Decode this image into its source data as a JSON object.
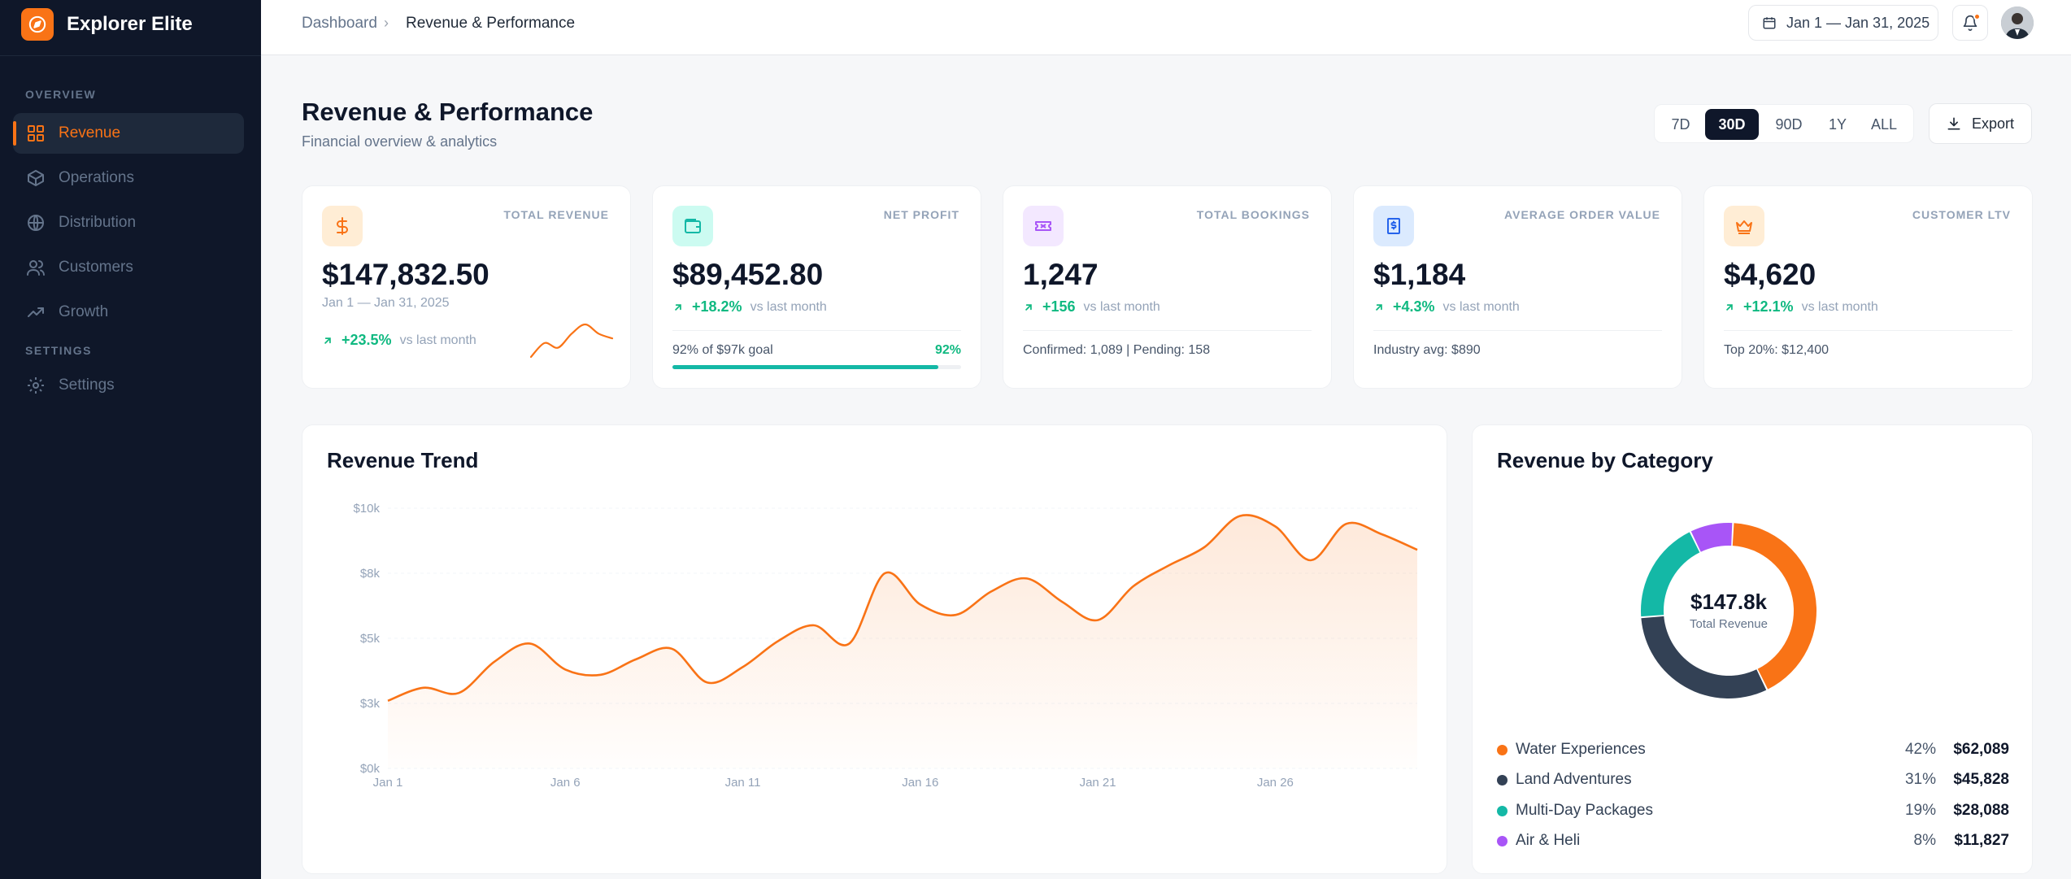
{
  "app": {
    "name": "Explorer Elite"
  },
  "sidebar": {
    "sections": [
      "OVERVIEW",
      "SETTINGS"
    ],
    "items": [
      {
        "label": "Revenue",
        "icon": "grid-icon",
        "active": true
      },
      {
        "label": "Operations",
        "icon": "box-icon"
      },
      {
        "label": "Distribution",
        "icon": "globe-icon"
      },
      {
        "label": "Customers",
        "icon": "users-icon"
      },
      {
        "label": "Growth",
        "icon": "trend-icon"
      }
    ],
    "settings_item": {
      "label": "Settings",
      "icon": "gear-icon"
    }
  },
  "topbar": {
    "breadcrumb": [
      "Dashboard",
      "Revenue & Performance"
    ],
    "date_range": "Jan 1 — Jan 31, 2025"
  },
  "header": {
    "title": "Revenue & Performance",
    "subtitle": "Financial overview & analytics",
    "ranges": [
      "7D",
      "30D",
      "90D",
      "1Y",
      "ALL"
    ],
    "active_range": "30D",
    "export_label": "Export"
  },
  "kpis": [
    {
      "label": "TOTAL REVENUE",
      "value": "$147,832.50",
      "date": "Jan 1 — Jan 31, 2025",
      "change": "+23.5%",
      "vs": "vs last month",
      "icon": "dollar-icon",
      "accent": "#f97316",
      "icon_bg": "#ffedd5",
      "sparkline": [
        3,
        6,
        5,
        8,
        10,
        8,
        7
      ]
    },
    {
      "label": "NET PROFIT",
      "value": "$89,452.80",
      "change": "+18.2%",
      "vs": "vs last month",
      "footer": "92% of $97k goal",
      "footer_right": "92%",
      "progress": 0.92,
      "icon": "wallet-icon",
      "accent": "#14b8a6",
      "icon_bg": "#ccfbf1"
    },
    {
      "label": "TOTAL BOOKINGS",
      "value": "1,247",
      "change": "+156",
      "vs": "vs last month",
      "footer": "Confirmed: 1,089 | Pending: 158",
      "icon": "ticket-icon",
      "accent": "#a855f7",
      "icon_bg": "#f3e8ff"
    },
    {
      "label": "AVERAGE ORDER VALUE",
      "value": "$1,184",
      "change": "+4.3%",
      "vs": "vs last month",
      "footer": "Industry avg: $890",
      "icon": "receipt-icon",
      "accent": "#2563eb",
      "icon_bg": "#dbeafe"
    },
    {
      "label": "CUSTOMER LTV",
      "value": "$4,620",
      "change": "+12.1%",
      "vs": "vs last month",
      "footer": "Top 20%: $12,400",
      "icon": "crown-icon",
      "accent": "#f97316",
      "icon_bg": "#ffedd5"
    }
  ],
  "trend": {
    "title": "Revenue Trend",
    "color": "#f97316"
  },
  "category": {
    "title": "Revenue by Category",
    "center_value": "$147.8k",
    "center_label": "Total Revenue",
    "items": [
      {
        "name": "Water Experiences",
        "pct": "42%",
        "value": "$62,089",
        "color": "#f97316"
      },
      {
        "name": "Land Adventures",
        "pct": "31%",
        "value": "$45,828",
        "color": "#334155"
      },
      {
        "name": "Multi-Day Packages",
        "pct": "19%",
        "value": "$28,088",
        "color": "#14b8a6"
      },
      {
        "name": "Air & Heli",
        "pct": "8%",
        "value": "$11,827",
        "color": "#a855f7"
      }
    ]
  },
  "chart_data": [
    {
      "type": "area",
      "title": "Revenue Trend",
      "xlabel": "",
      "ylabel": "",
      "x": [
        "Jan 1",
        "Jan 2",
        "Jan 3",
        "Jan 4",
        "Jan 5",
        "Jan 6",
        "Jan 7",
        "Jan 8",
        "Jan 9",
        "Jan 10",
        "Jan 11",
        "Jan 12",
        "Jan 13",
        "Jan 14",
        "Jan 15",
        "Jan 16",
        "Jan 17",
        "Jan 18",
        "Jan 19",
        "Jan 20",
        "Jan 21",
        "Jan 22",
        "Jan 23",
        "Jan 24",
        "Jan 25",
        "Jan 26",
        "Jan 27",
        "Jan 28",
        "Jan 29",
        "Jan 30"
      ],
      "xticks": [
        "Jan 1",
        "Jan 6",
        "Jan 11",
        "Jan 16",
        "Jan 21",
        "Jan 26"
      ],
      "yticks": [
        "$0k",
        "$3k",
        "$5k",
        "$8k",
        "$10k"
      ],
      "ylim": [
        0,
        10000
      ],
      "grid": true,
      "series": [
        {
          "values": [
            2600,
            3100,
            2900,
            4100,
            4800,
            3800,
            3600,
            4200,
            4600,
            3300,
            3900,
            4900,
            5500,
            4800,
            7500,
            6300,
            5900,
            6800,
            7300,
            6400,
            5700,
            7000,
            7800,
            8500,
            9700,
            9300,
            8000,
            9400,
            9000,
            8400
          ]
        }
      ]
    },
    {
      "type": "pie",
      "title": "Revenue by Category",
      "categories": [
        "Water Experiences",
        "Land Adventures",
        "Multi-Day Packages",
        "Air & Heli"
      ],
      "values": [
        62089,
        45828,
        28088,
        11827
      ],
      "legend": "bottom"
    }
  ]
}
